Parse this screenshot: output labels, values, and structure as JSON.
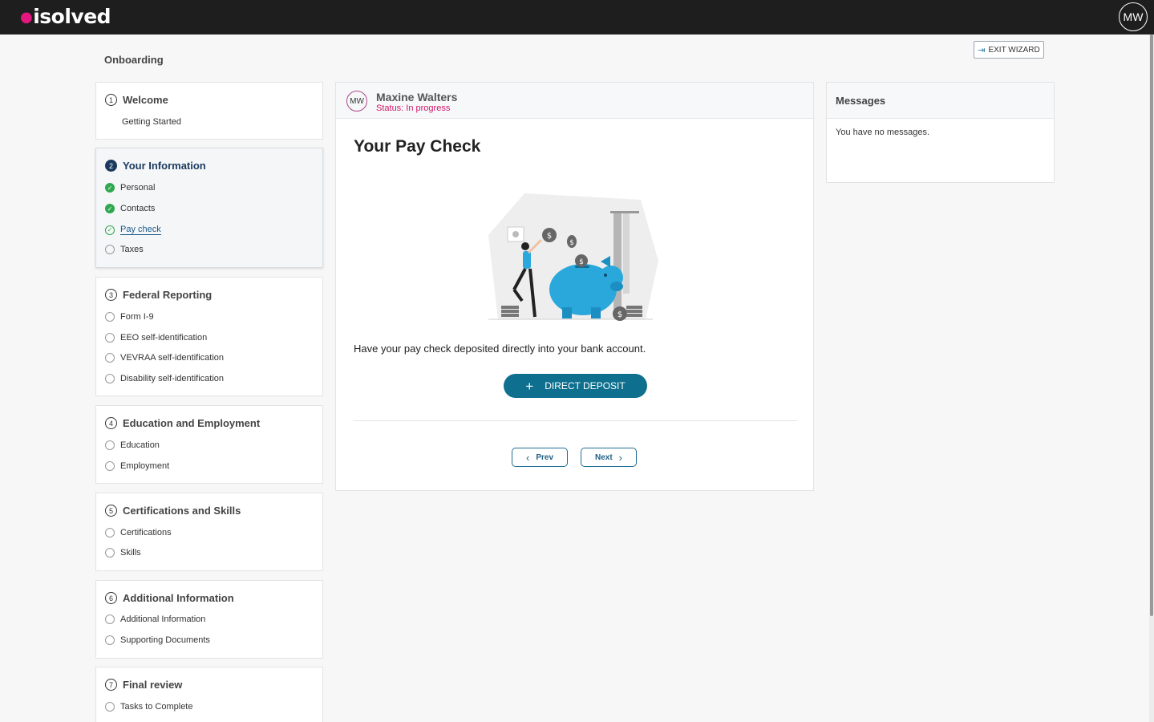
{
  "app": {
    "logo": "isolved",
    "avatar_initials": "MW"
  },
  "header": {
    "page_title": "Onboarding",
    "exit_label": "EXIT WIZARD"
  },
  "steps": [
    {
      "num": "1",
      "title": "Welcome",
      "items": [
        {
          "label": "Getting Started",
          "state": "none"
        }
      ]
    },
    {
      "num": "2",
      "title": "Your Information",
      "items": [
        {
          "label": "Personal",
          "state": "done"
        },
        {
          "label": "Contacts",
          "state": "done"
        },
        {
          "label": "Pay check",
          "state": "current"
        },
        {
          "label": "Taxes",
          "state": "todo"
        }
      ]
    },
    {
      "num": "3",
      "title": "Federal Reporting",
      "items": [
        {
          "label": "Form I-9",
          "state": "todo"
        },
        {
          "label": "EEO self-identification",
          "state": "todo"
        },
        {
          "label": "VEVRAA self-identification",
          "state": "todo"
        },
        {
          "label": "Disability self-identification",
          "state": "todo"
        }
      ]
    },
    {
      "num": "4",
      "title": "Education and Employment",
      "items": [
        {
          "label": "Education",
          "state": "todo"
        },
        {
          "label": "Employment",
          "state": "todo"
        }
      ]
    },
    {
      "num": "5",
      "title": "Certifications and Skills",
      "items": [
        {
          "label": "Certifications",
          "state": "todo"
        },
        {
          "label": "Skills",
          "state": "todo"
        }
      ]
    },
    {
      "num": "6",
      "title": "Additional Information",
      "items": [
        {
          "label": "Additional Information",
          "state": "todo"
        },
        {
          "label": "Supporting Documents",
          "state": "todo"
        }
      ]
    },
    {
      "num": "7",
      "title": "Final review",
      "items": [
        {
          "label": "Tasks to Complete",
          "state": "todo"
        }
      ]
    }
  ],
  "main": {
    "user_initials": "MW",
    "user_name": "Maxine Walters",
    "status": "Status: In progress",
    "title": "Your Pay Check",
    "description": "Have your pay check deposited directly into your bank account.",
    "direct_deposit_label": "DIRECT DEPOSIT",
    "prev_label": "Prev",
    "next_label": "Next"
  },
  "messages": {
    "title": "Messages",
    "empty_text": "You have no messages."
  },
  "colors": {
    "accent": "#0e6f8e",
    "status": "#d1146a",
    "done": "#2fa84f",
    "nav_dark": "#1c3a5e"
  }
}
